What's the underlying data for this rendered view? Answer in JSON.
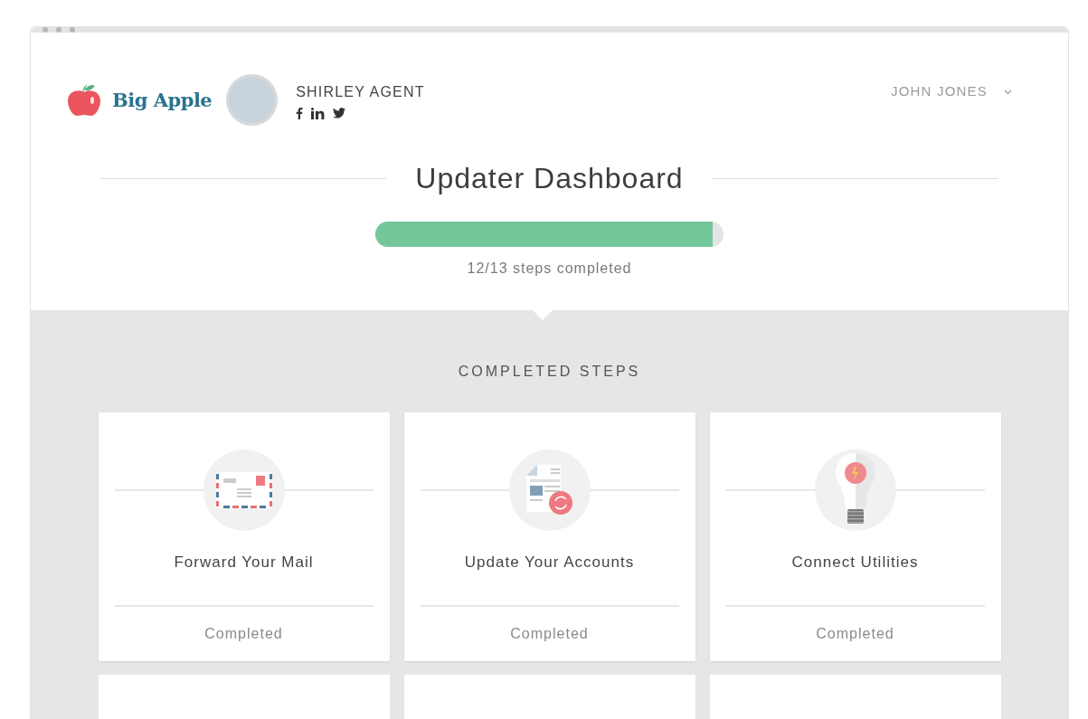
{
  "brand": {
    "name": "Big Apple"
  },
  "agent": {
    "name": "SHIRLEY AGENT",
    "socials": [
      {
        "kind": "facebook"
      },
      {
        "kind": "linkedin"
      },
      {
        "kind": "twitter"
      }
    ]
  },
  "user_menu": {
    "label": "JOHN JONES"
  },
  "title": "Updater Dashboard",
  "progress": {
    "level": 0.97,
    "caption": "12/13 steps completed"
  },
  "section_title": "COMPLETED STEPS",
  "cards": [
    {
      "kind": "mail",
      "title": "Forward Your Mail",
      "status": "Completed"
    },
    {
      "kind": "accounts",
      "title": "Update Your Accounts",
      "status": "Completed"
    },
    {
      "kind": "utilities",
      "title": "Connect Utilities",
      "status": "Completed"
    }
  ],
  "cards_below": [
    {
      "kind": "card"
    },
    {
      "kind": "card"
    },
    {
      "kind": "card"
    }
  ]
}
